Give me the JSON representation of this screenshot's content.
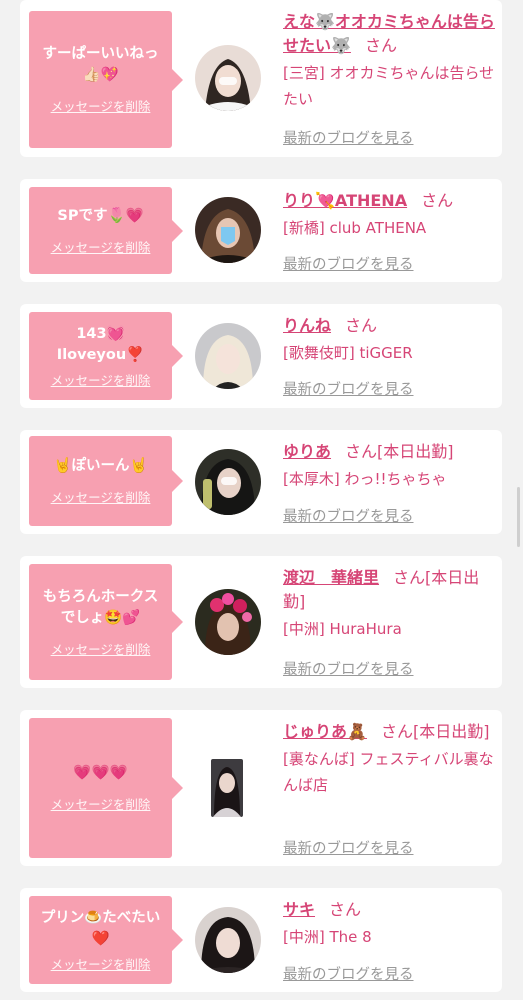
{
  "cards": [
    {
      "message": "すーぱーいいねっ\n👍🏻💖",
      "delete_label": "メッセージを削除",
      "name": "えな🐺オオカミちゃんは告らせたい🐺",
      "honorific": "さん",
      "status": "",
      "shop": "[三宮] オオカミちゃんは告らせたい",
      "blog_label": "最新のブログを見る",
      "avatar": "avatar-girl-white"
    },
    {
      "message": "SPです🌷💗",
      "delete_label": "メッセージを削除",
      "name": "りり💘ATHENA",
      "honorific": "さん",
      "status": "",
      "shop": "[新橋] club ATHENA",
      "blog_label": "最新のブログを見る",
      "avatar": "avatar-girl-dark"
    },
    {
      "message": "143💓\nIloveyou❣️",
      "delete_label": "メッセージを削除",
      "name": "りんね",
      "honorific": "さん",
      "status": "",
      "shop": "[歌舞伎町] tiGGER",
      "blog_label": "最新のブログを見る",
      "avatar": "avatar-girl-blonde"
    },
    {
      "message": "🤘ぽいーん🤘",
      "delete_label": "メッセージを削除",
      "name": "ゆりあ",
      "honorific": "さん",
      "status": "[本日出勤]",
      "shop": "[本厚木] わっ!!ちゃちゃ",
      "blog_label": "最新のブログを見る",
      "avatar": "avatar-girl-night"
    },
    {
      "message": "もちろんホークス\nでしょ🤩💕",
      "delete_label": "メッセージを削除",
      "name": "渡辺　華緒里",
      "honorific": "さん",
      "status": "[本日出勤]",
      "shop": "[中洲] HuraHura",
      "blog_label": "最新のブログを見る",
      "avatar": "avatar-girl-flowers"
    },
    {
      "message": "💗💗💗",
      "delete_label": "メッセージを削除",
      "name": "じゅりあ🧸",
      "honorific": "さん",
      "status": "[本日出勤]",
      "shop": "[裏なんば] フェスティバル裏なんば店",
      "blog_label": "最新のブログを見る",
      "avatar": "avatar-girl-portrait"
    },
    {
      "message": "プリン🍮たべたい\n❤️",
      "delete_label": "メッセージを削除",
      "name": "サキ",
      "honorific": "さん",
      "status": "",
      "shop": "[中洲] The 8",
      "blog_label": "最新のブログを見る",
      "avatar": "avatar-girl-dark"
    }
  ],
  "colors": {
    "accent": "#d64576",
    "bubble": "#f7a0b1",
    "muted": "#999999",
    "background": "#f2f2f2"
  }
}
